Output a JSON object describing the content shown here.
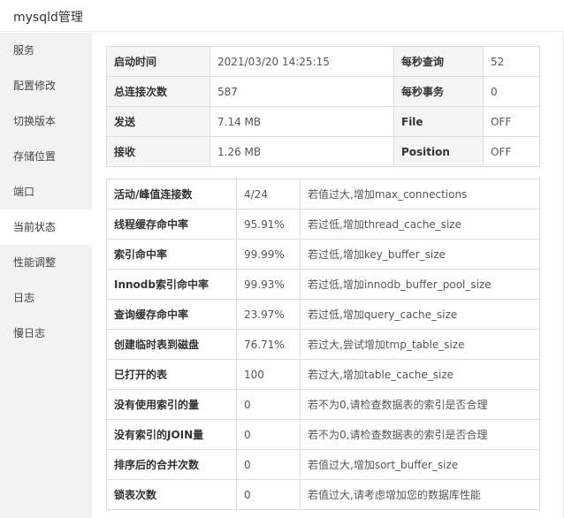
{
  "window": {
    "title": "mysqld管理"
  },
  "sidebar": {
    "items": [
      {
        "label": "服务",
        "active": false
      },
      {
        "label": "配置修改",
        "active": false
      },
      {
        "label": "切换版本",
        "active": false
      },
      {
        "label": "存储位置",
        "active": false
      },
      {
        "label": "端口",
        "active": false
      },
      {
        "label": "当前状态",
        "active": true
      },
      {
        "label": "性能调整",
        "active": false
      },
      {
        "label": "日志",
        "active": false
      },
      {
        "label": "慢日志",
        "active": false
      }
    ]
  },
  "overview": [
    {
      "k1": "启动时间",
      "v1": "2021/03/20 14:25:15",
      "k2": "每秒查询",
      "v2": "52"
    },
    {
      "k1": "总连接次数",
      "v1": "587",
      "k2": "每秒事务",
      "v2": "0"
    },
    {
      "k1": "发送",
      "v1": "7.14 MB",
      "k2": "File",
      "v2": "OFF"
    },
    {
      "k1": "接收",
      "v1": "1.26 MB",
      "k2": "Position",
      "v2": "OFF"
    }
  ],
  "metrics": [
    {
      "name": "活动/峰值连接数",
      "value": "4/24",
      "hint": "若值过大,增加max_connections"
    },
    {
      "name": "线程缓存命中率",
      "value": "95.91%",
      "hint": "若过低,增加thread_cache_size"
    },
    {
      "name": "索引命中率",
      "value": "99.99%",
      "hint": "若过低,增加key_buffer_size"
    },
    {
      "name": "Innodb索引命中率",
      "value": "99.93%",
      "hint": "若过低,增加innodb_buffer_pool_size"
    },
    {
      "name": "查询缓存命中率",
      "value": "23.97%",
      "hint": "若过低,增加query_cache_size"
    },
    {
      "name": "创建临时表到磁盘",
      "value": "76.71%",
      "hint": "若过大,尝试增加tmp_table_size"
    },
    {
      "name": "已打开的表",
      "value": "100",
      "hint": "若过大,增加table_cache_size"
    },
    {
      "name": "没有使用索引的量",
      "value": "0",
      "hint": "若不为0,请检查数据表的索引是否合理"
    },
    {
      "name": "没有索引的JOIN量",
      "value": "0",
      "hint": "若不为0,请检查数据表的索引是否合理"
    },
    {
      "name": "排序后的合并次数",
      "value": "0",
      "hint": "若值过大,增加sort_buffer_size"
    },
    {
      "name": "锁表次数",
      "value": "0",
      "hint": "若值过大,请考虑增加您的数据库性能"
    }
  ]
}
